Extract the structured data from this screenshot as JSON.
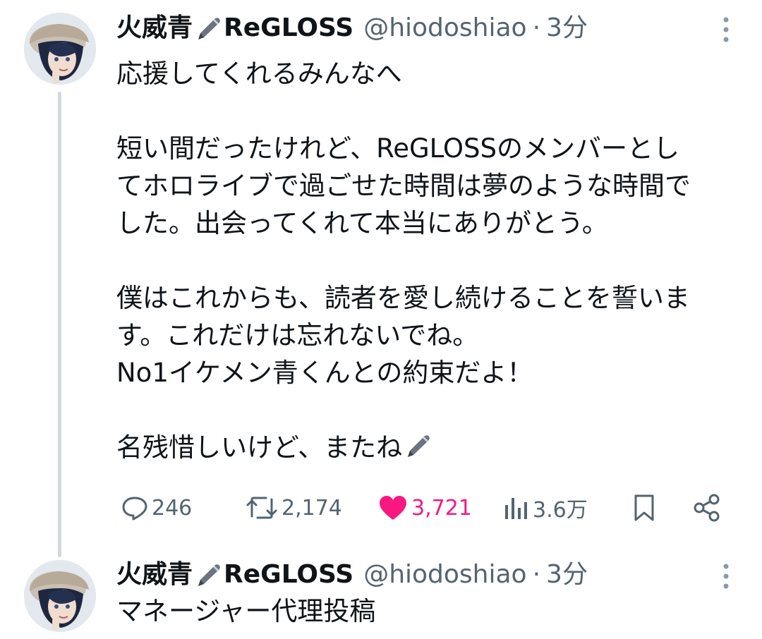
{
  "posts": [
    {
      "display_name": "火威青",
      "display_name_suffix": "ReGLOSS",
      "handle": "@hiodoshiao",
      "separator": "·",
      "time": "3分",
      "avatar_icon": "avatar-icon",
      "text": "応援してくれるみんなへ\n\n短い間だったけれど、ReGLOSSのメンバーとし\nてホロライブで過ごせた時間は夢のような時間で\nした。出会ってくれて本当にありがとう。\n\n僕はこれからも、読者を愛し続けることを誓いま\nす。これだけは忘れないでね。\nNo1イケメン青くんとの約束だよ！\n\n名残惜しいけど、またね",
      "actions": {
        "replies": "246",
        "reposts": "2,174",
        "likes": "3,721",
        "views": "3.6万"
      }
    },
    {
      "display_name": "火威青",
      "display_name_suffix": "ReGLOSS",
      "handle": "@hiodoshiao",
      "separator": "·",
      "time": "3分",
      "avatar_icon": "avatar-icon",
      "text": "マネージャー代理投稿"
    }
  ],
  "colors": {
    "text": "#0f1419",
    "secondary": "#536471",
    "like": "#f91880",
    "thread_line": "#cfd9de"
  }
}
